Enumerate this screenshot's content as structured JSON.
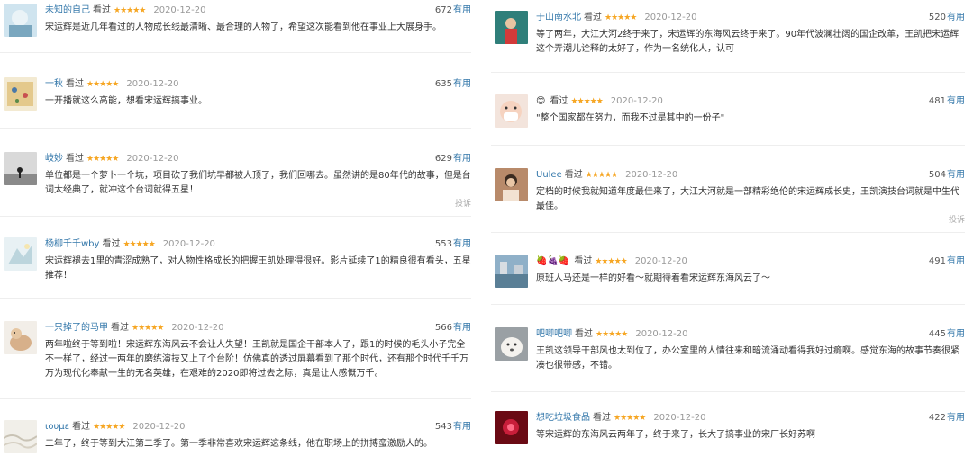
{
  "ui": {
    "watched_label": "看过",
    "useful_label": "有用",
    "report_label": "投诉",
    "stars": "★★★★★"
  },
  "left": [
    {
      "user": "未知的自己",
      "date": "2020-12-20",
      "votes": "672",
      "text": "宋运辉是近几年看过的人物成长线最清晰、最合理的人物了，希望这次能看到他在事业上大展身手。"
    },
    {
      "user": "一秋",
      "date": "2020-12-20",
      "votes": "635",
      "text": "一开播就这么高能，想看宋运辉搞事业。"
    },
    {
      "user": "岐妙",
      "date": "2020-12-20",
      "votes": "629",
      "text": "单位都是一个萝卜一个坑，项目砍了我们坑早都被人顶了，我们回哪去。虽然讲的是80年代的故事，但是台词太经典了，就冲这个台词就得五星！"
    },
    {
      "user": "杨柳千千wby",
      "date": "2020-12-20",
      "votes": "553",
      "text": "宋运辉褪去1里的青涩成熟了，对人物性格成长的把握王凯处理得很好。影片延续了1的精良很有看头，五星推荐！"
    },
    {
      "user": "一只掉了的马甲",
      "date": "2020-12-20",
      "votes": "566",
      "text": "两年啦终于等到啦！宋运辉东海风云不会让人失望！王凯就是国企干部本人了，跟1的时候的毛头小子完全不一样了，经过一两年的磨练演技又上了个台阶！仿佛真的透过屏幕看到了那个时代，还有那个时代千千万万为现代化奉献一生的无名英雄，在艰难的2020即将过去之际，真是让人感慨万千。"
    },
    {
      "user": "ιουμε",
      "date": "2020-12-20",
      "votes": "543",
      "text": "二年了，终于等到大江第二季了。第一季非常喜欢宋运辉这条线，他在职场上的拼搏蛮激励人的。"
    }
  ],
  "right": [
    {
      "user": "于山南水北",
      "date": "2020-12-20",
      "votes": "520",
      "text": "等了两年，大江大河2终于来了，宋运辉的东海风云终于来了。90年代波澜壮阔的国企改革，王凯把宋运辉这个弄潮儿诠释的太好了，作为一名统化人，认可"
    },
    {
      "user": "",
      "date": "2020-12-20",
      "votes": "481",
      "text": "\"整个国家都在努力，而我不过是其中的一份子\""
    },
    {
      "user": "Uulee",
      "date": "2020-12-20",
      "votes": "504",
      "text": "定档的时候我就知道年度最佳来了，大江大河就是一部精彩绝伦的宋运辉成长史，王凯演技台词就是中生代最佳。"
    },
    {
      "user": "",
      "date": "2020-12-20",
      "votes": "491",
      "text": "原班人马还是一样的好看～就期待着看宋运辉东海风云了～"
    },
    {
      "user": "吧唧吧唧",
      "date": "2020-12-20",
      "votes": "445",
      "text": "王凯这领导干部风也太到位了，办公室里的人情往来和暗流涌动看得我好过瘾啊。感觉东海的故事节奏很紧凑也很带感，不错。"
    },
    {
      "user": "想吃垃圾食品",
      "date": "2020-12-20",
      "votes": "422",
      "text": "等宋运辉的东海风云两年了，终于来了，长大了搞事业的宋厂长好苏啊"
    }
  ]
}
